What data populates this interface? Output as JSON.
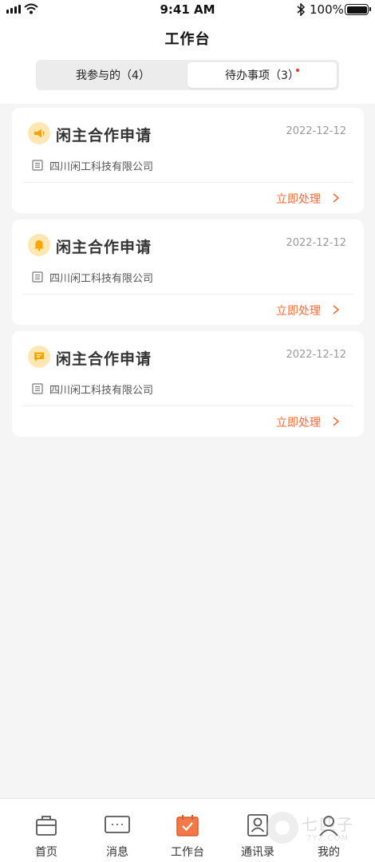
{
  "status_bar": {
    "time": "9:41 AM",
    "battery": "100%"
  },
  "header": {
    "title": "工作台"
  },
  "segments": [
    {
      "label": "我参与的（4）",
      "active": false
    },
    {
      "label": "待办事项（3）",
      "active": true,
      "has_badge_dot": true
    }
  ],
  "cards": [
    {
      "icon": "megaphone-icon",
      "title": "闲主合作申请",
      "date": "2022-12-12",
      "company": "四川闲工科技有限公司",
      "action": "立即处理"
    },
    {
      "icon": "bell-icon",
      "title": "闲主合作申请",
      "date": "2022-12-12",
      "company": "四川闲工科技有限公司",
      "action": "立即处理"
    },
    {
      "icon": "message-icon",
      "title": "闲主合作申请",
      "date": "2022-12-12",
      "company": "四川闲工科技有限公司",
      "action": "立即处理"
    }
  ],
  "tabbar": {
    "items": [
      {
        "label": "首页",
        "icon": "briefcase-icon",
        "active": false
      },
      {
        "label": "消息",
        "icon": "chat-icon",
        "active": false
      },
      {
        "label": "工作台",
        "icon": "calendar-check-icon",
        "active": true
      },
      {
        "label": "通讯录",
        "icon": "contacts-icon",
        "active": false
      },
      {
        "label": "我的",
        "icon": "user-icon",
        "active": false
      }
    ]
  },
  "watermark": {
    "text": "七匹子",
    "sub": "7YZ.COM"
  },
  "colors": {
    "accent": "#f26b3a",
    "icon_bg": "#ffe7b3",
    "icon_fg": "#f7a500",
    "page_bg": "#f5f5f5",
    "badge": "#e53935"
  }
}
